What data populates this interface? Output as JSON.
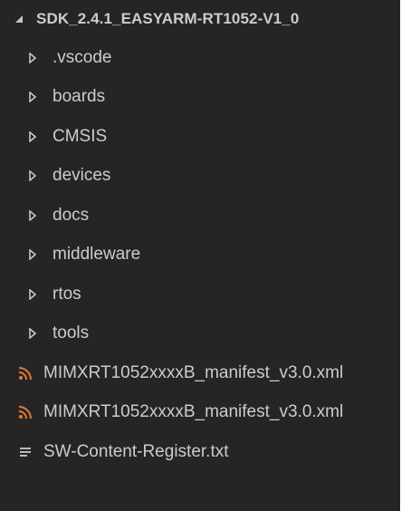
{
  "explorer": {
    "root": {
      "label": "SDK_2.4.1_EASYARM-RT1052-V1_0",
      "icon": "chevron-down-icon"
    },
    "folders": [
      {
        "label": ".vscode"
      },
      {
        "label": "boards"
      },
      {
        "label": "CMSIS"
      },
      {
        "label": "devices"
      },
      {
        "label": "docs"
      },
      {
        "label": "middleware"
      },
      {
        "label": "rtos"
      },
      {
        "label": "tools"
      }
    ],
    "files": [
      {
        "label": "MIMXRT1052xxxxB_manifest_v3.0.xml",
        "icon": "rss-feed-icon"
      },
      {
        "label": "MIMXRT1052xxxxB_manifest_v3.0.xml",
        "icon": "rss-feed-icon"
      },
      {
        "label": "SW-Content-Register.txt",
        "icon": "text-lines-icon"
      }
    ]
  },
  "colors": {
    "background": "#252526",
    "text": "#cccccc",
    "xml_icon": "#e37933",
    "twisty": "#c5c5c5"
  }
}
